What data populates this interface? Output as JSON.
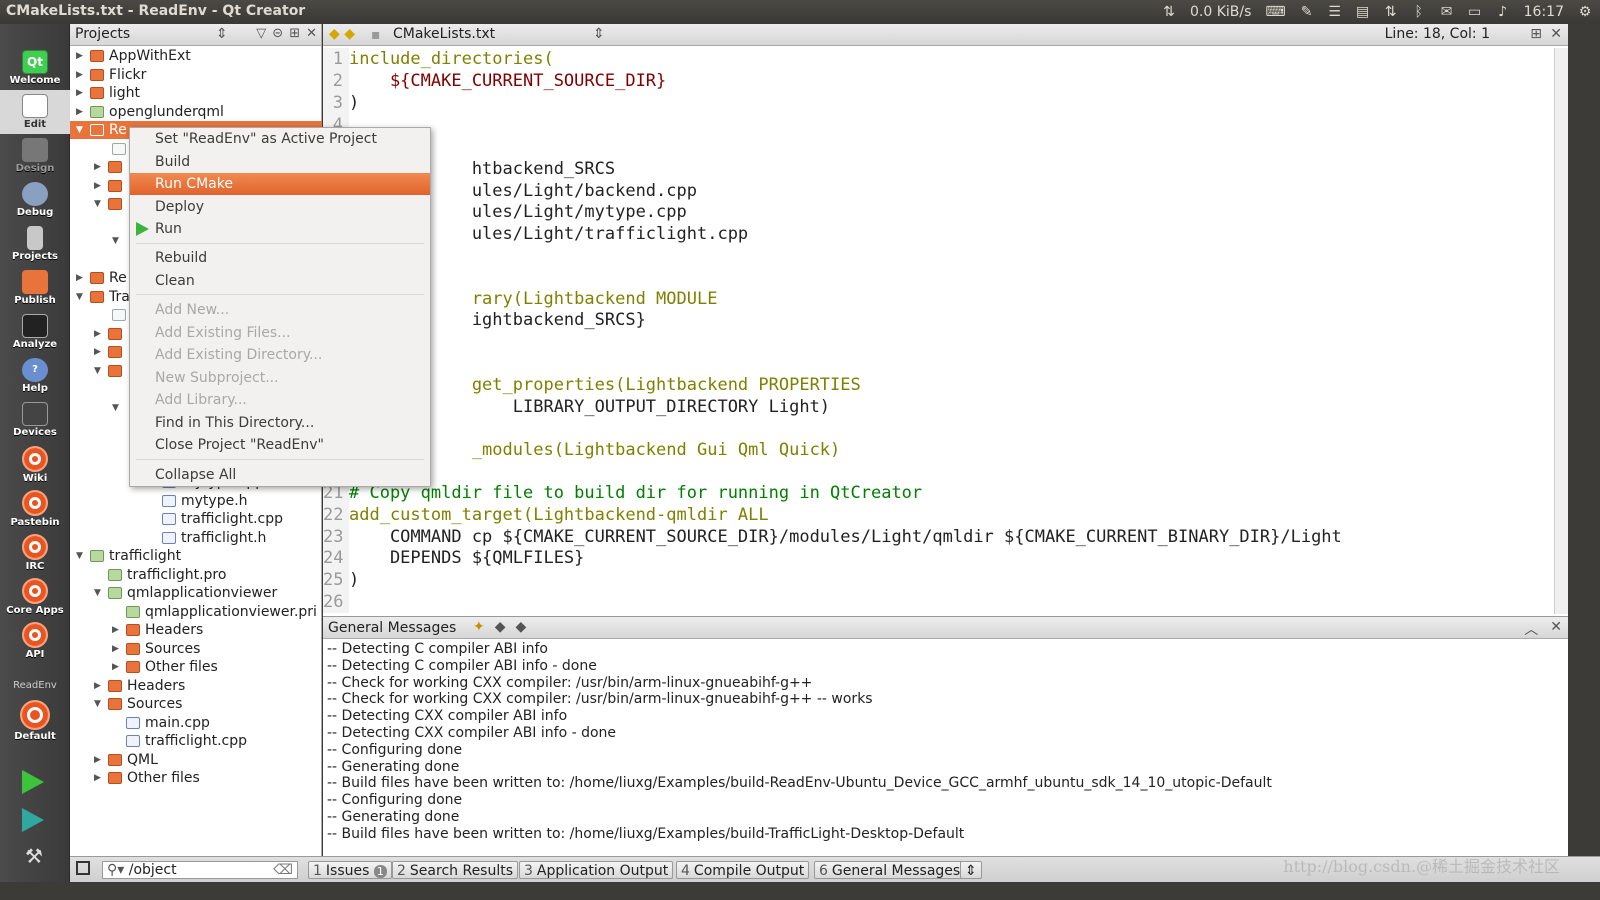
{
  "window": {
    "title": "CMakeLists.txt - ReadEnv - Qt Creator"
  },
  "tray": {
    "net_icon": "arrows-updown-icon",
    "net_speed": "0.0 KiB/s",
    "icons": [
      "keyboard-icon",
      "clip-icon",
      "menu-icon",
      "clipboard-icon",
      "network-icon",
      "bluetooth-icon",
      "mail-icon",
      "battery-icon",
      "volume-icon"
    ],
    "time": "16:17",
    "gear_icon": "gear-icon"
  },
  "modes": [
    {
      "label": "Welcome",
      "icon": "qt-logo-icon"
    },
    {
      "label": "Edit",
      "icon": "edit-icon"
    },
    {
      "label": "Design",
      "icon": "design-icon"
    },
    {
      "label": "Debug",
      "icon": "debug-icon"
    },
    {
      "label": "Projects",
      "icon": "projects-icon"
    },
    {
      "label": "Publish",
      "icon": "publish-icon"
    },
    {
      "label": "Analyze",
      "icon": "analyze-icon"
    },
    {
      "label": "Help",
      "icon": "help-icon"
    },
    {
      "label": "Devices",
      "icon": "devices-icon"
    },
    {
      "label": "Wiki",
      "icon": "ubuntu-icon"
    },
    {
      "label": "Pastebin",
      "icon": "ubuntu-icon"
    },
    {
      "label": "IRC",
      "icon": "ubuntu-icon"
    },
    {
      "label": "Core Apps",
      "icon": "ubuntu-icon"
    },
    {
      "label": "API",
      "icon": "ubuntu-icon"
    }
  ],
  "kit": {
    "project": "ReadEnv",
    "label": "Default"
  },
  "sidebar": {
    "title": "Projects",
    "tree": [
      {
        "label": "AppWithExt"
      },
      {
        "label": "Flickr"
      },
      {
        "label": "light"
      },
      {
        "label": "openglunderqml"
      },
      {
        "label": "Re"
      },
      {
        "label": "Re"
      },
      {
        "label": "Tra"
      },
      {
        "label": "mytype.cpp"
      },
      {
        "label": "mytype.h"
      },
      {
        "label": "trafficlight.cpp"
      },
      {
        "label": "trafficlight.h"
      },
      {
        "label": "trafficlight"
      },
      {
        "label": "trafficlight.pro"
      },
      {
        "label": "qmlapplicationviewer"
      },
      {
        "label": "qmlapplicationviewer.pri"
      },
      {
        "label": "Headers"
      },
      {
        "label": "Sources"
      },
      {
        "label": "Other files"
      },
      {
        "label": "Headers"
      },
      {
        "label": "Sources"
      },
      {
        "label": "main.cpp"
      },
      {
        "label": "trafficlight.cpp"
      },
      {
        "label": "QML"
      },
      {
        "label": "Other files"
      }
    ]
  },
  "editor": {
    "file": "CMakeLists.txt",
    "position": "Line: 18, Col: 1",
    "lines": [
      {
        "n": "1",
        "t": "include_directories("
      },
      {
        "n": "2",
        "t": "    ${CMAKE_CURRENT_SOURCE_DIR}"
      },
      {
        "n": "3",
        "t": ")"
      },
      {
        "n": "4",
        "t": ""
      },
      {
        "n": "",
        "t": "            htbackend_SRCS"
      },
      {
        "n": "",
        "t": "            ules/Light/backend.cpp"
      },
      {
        "n": "",
        "t": "            ules/Light/mytype.cpp"
      },
      {
        "n": "",
        "t": "            ules/Light/trafficlight.cpp"
      },
      {
        "n": "",
        "t": ""
      },
      {
        "n": "",
        "t": ""
      },
      {
        "n": "",
        "t": "            rary(Lightbackend MODULE"
      },
      {
        "n": "",
        "t": "            ightbackend_SRCS}"
      },
      {
        "n": "",
        "t": ""
      },
      {
        "n": "",
        "t": ""
      },
      {
        "n": "",
        "t": "            get_properties(Lightbackend PROPERTIES"
      },
      {
        "n": "",
        "t": "                LIBRARY_OUTPUT_DIRECTORY Light)"
      },
      {
        "n": "",
        "t": ""
      },
      {
        "n": "",
        "t": "            _modules(Lightbackend Gui Qml Quick)"
      },
      {
        "n": "",
        "t": ""
      },
      {
        "n": "21",
        "t": "# Copy qmldir file to build dir for running in QtCreator"
      },
      {
        "n": "22",
        "t": "add_custom_target(Lightbackend-qmldir ALL"
      },
      {
        "n": "23",
        "t": "    COMMAND cp ${CMAKE_CURRENT_SOURCE_DIR}/modules/Light/qmldir ${CMAKE_CURRENT_BINARY_DIR}/Light"
      },
      {
        "n": "24",
        "t": "    DEPENDS ${QMLFILES}"
      },
      {
        "n": "25",
        "t": ")"
      },
      {
        "n": "26",
        "t": ""
      }
    ]
  },
  "context_menu": {
    "items": [
      {
        "label": "Set \"ReadEnv\" as Active Project",
        "enabled": true
      },
      {
        "label": "Build",
        "enabled": true
      },
      {
        "label": "Run CMake",
        "enabled": true,
        "highlighted": true
      },
      {
        "label": "Deploy",
        "enabled": true
      },
      {
        "label": "Run",
        "enabled": true
      },
      {
        "label": "Rebuild",
        "enabled": true
      },
      {
        "label": "Clean",
        "enabled": true
      },
      {
        "label": "Add New...",
        "enabled": false
      },
      {
        "label": "Add Existing Files...",
        "enabled": false
      },
      {
        "label": "Add Existing Directory...",
        "enabled": false
      },
      {
        "label": "New Subproject...",
        "enabled": false
      },
      {
        "label": "Add Library...",
        "enabled": false
      },
      {
        "label": "Find in This Directory...",
        "enabled": true
      },
      {
        "label": "Close Project \"ReadEnv\"",
        "enabled": true
      },
      {
        "label": "Collapse All",
        "enabled": true
      }
    ]
  },
  "output": {
    "title": "General Messages",
    "lines": [
      "-- Detecting C compiler ABI info",
      "-- Detecting C compiler ABI info - done",
      "-- Check for working CXX compiler: /usr/bin/arm-linux-gnueabihf-g++",
      "-- Check for working CXX compiler: /usr/bin/arm-linux-gnueabihf-g++ -- works",
      "-- Detecting CXX compiler ABI info",
      "-- Detecting CXX compiler ABI info - done",
      "-- Configuring done",
      "-- Generating done",
      "-- Build files have been written to: /home/liuxg/Examples/build-ReadEnv-Ubuntu_Device_GCC_armhf_ubuntu_sdk_14_10_utopic-Default",
      "-- Configuring done",
      "-- Generating done",
      "-- Build files have been written to: /home/liuxg/Examples/build-TrafficLight-Desktop-Default"
    ]
  },
  "statusbar": {
    "locator": "/object",
    "tabs": [
      {
        "num": "1",
        "label": "Issues",
        "badge": "1"
      },
      {
        "num": "2",
        "label": "Search Results"
      },
      {
        "num": "3",
        "label": "Application Output"
      },
      {
        "num": "4",
        "label": "Compile Output"
      },
      {
        "num": "6",
        "label": "General Messages"
      }
    ]
  },
  "watermark": "http://blog.csdn.@稀土掘金技术社区"
}
